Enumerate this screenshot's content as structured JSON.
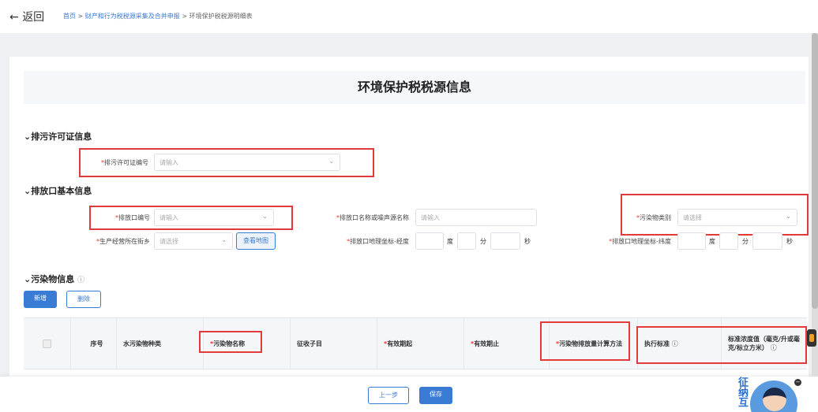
{
  "header": {
    "back_label": "返回",
    "breadcrumb": [
      "首页",
      "财产和行为税税源采集及合并申报",
      "环境保护税税源明细表"
    ]
  },
  "page_title": "环境保护税税源信息",
  "sections": {
    "permit": {
      "title": "排污许可证信息",
      "field_label": "排污许可证编号",
      "placeholder": "请输入"
    },
    "outlet": {
      "title": "排放口基本信息",
      "outlet_no_label": "排放口编号",
      "outlet_no_placeholder": "请输入",
      "outlet_name_label": "排放口名称或噪声源名称",
      "outlet_name_placeholder": "请输入",
      "pollutant_type_label": "污染物类别",
      "pollutant_type_placeholder": "请选择",
      "street_label": "生产经营所在街乡",
      "street_placeholder": "请选择",
      "map_button": "查看地图",
      "longitude_label": "排放口地理坐标-经度",
      "latitude_label": "排放口地理坐标-纬度",
      "deg": "度",
      "min": "分",
      "sec": "秒"
    },
    "pollutant": {
      "title": "污染物信息",
      "add_button": "新增",
      "delete_button": "删除",
      "columns": [
        "序号",
        "水污染物种类",
        "污染物名称",
        "征收子目",
        "有效期起",
        "有效期止",
        "污染物排放量计算方法",
        "执行标准",
        "标准浓度值（毫克/升或毫克/标立方米）"
      ]
    }
  },
  "footer": {
    "prev_button": "上一步",
    "save_button": "保存"
  },
  "mascot": {
    "text": "征纳互"
  },
  "colors": {
    "primary": "#3a7bd5",
    "highlight": "#e03a3a"
  }
}
